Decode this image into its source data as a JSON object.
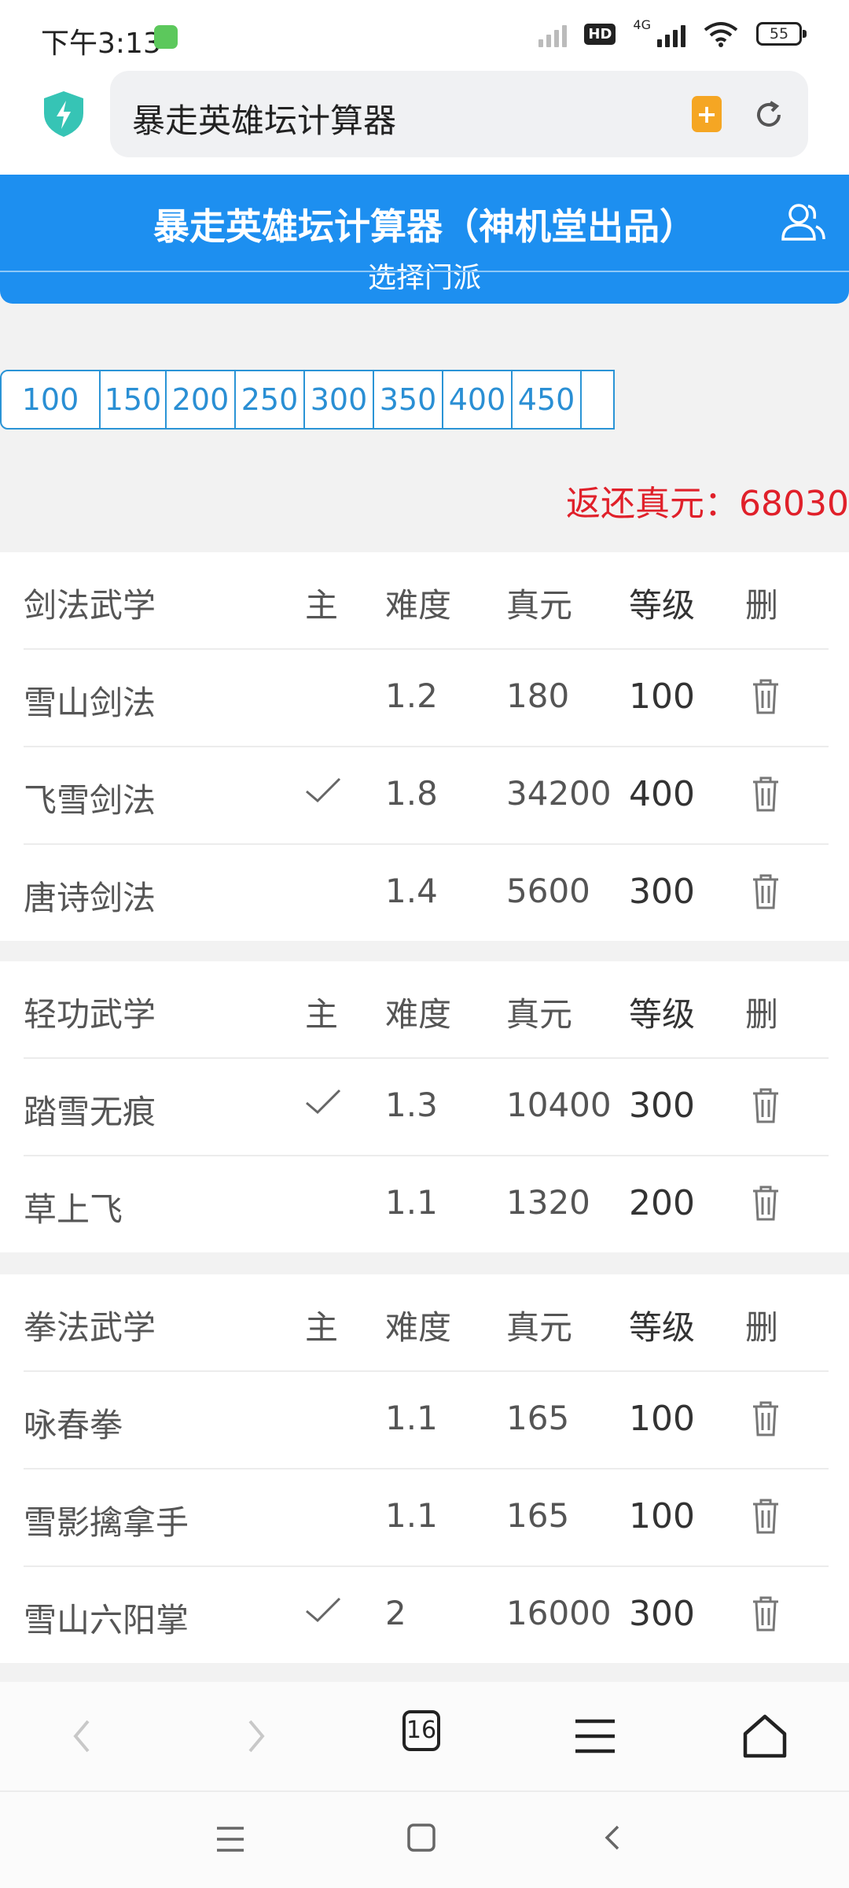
{
  "status": {
    "time": "下午3:13",
    "network": "4G",
    "hd": "HD",
    "battery": "55"
  },
  "browser": {
    "url_title": "暴走英雄坛计算器",
    "tab_count": "16"
  },
  "header": {
    "title": "暴走英雄坛计算器（神机堂出品）",
    "subtitle": "选择门派"
  },
  "levels": [
    "100",
    "150",
    "200",
    "250",
    "300",
    "350",
    "400",
    "450"
  ],
  "refund": {
    "label": "返还真元：",
    "value": "68030"
  },
  "columns": {
    "main": "主",
    "difficulty": "难度",
    "yuan": "真元",
    "level": "等级",
    "delete": "删"
  },
  "sections": [
    {
      "title": "剑法武学",
      "rows": [
        {
          "name": "雪山剑法",
          "main": false,
          "difficulty": "1.2",
          "yuan": "180",
          "level": "100"
        },
        {
          "name": "飞雪剑法",
          "main": true,
          "difficulty": "1.8",
          "yuan": "34200",
          "level": "400"
        },
        {
          "name": "唐诗剑法",
          "main": false,
          "difficulty": "1.4",
          "yuan": "5600",
          "level": "300"
        }
      ]
    },
    {
      "title": "轻功武学",
      "rows": [
        {
          "name": "踏雪无痕",
          "main": true,
          "difficulty": "1.3",
          "yuan": "10400",
          "level": "300"
        },
        {
          "name": "草上飞",
          "main": false,
          "difficulty": "1.1",
          "yuan": "1320",
          "level": "200"
        }
      ]
    },
    {
      "title": "拳法武学",
      "rows": [
        {
          "name": "咏春拳",
          "main": false,
          "difficulty": "1.1",
          "yuan": "165",
          "level": "100"
        },
        {
          "name": "雪影擒拿手",
          "main": false,
          "difficulty": "1.1",
          "yuan": "165",
          "level": "100"
        },
        {
          "name": "雪山六阳掌",
          "main": true,
          "difficulty": "2",
          "yuan": "16000",
          "level": "300"
        }
      ]
    }
  ],
  "colors": {
    "header_blue": "#1d8ff0",
    "level_blue": "#2a94d6",
    "refund_red": "#e0202a"
  }
}
